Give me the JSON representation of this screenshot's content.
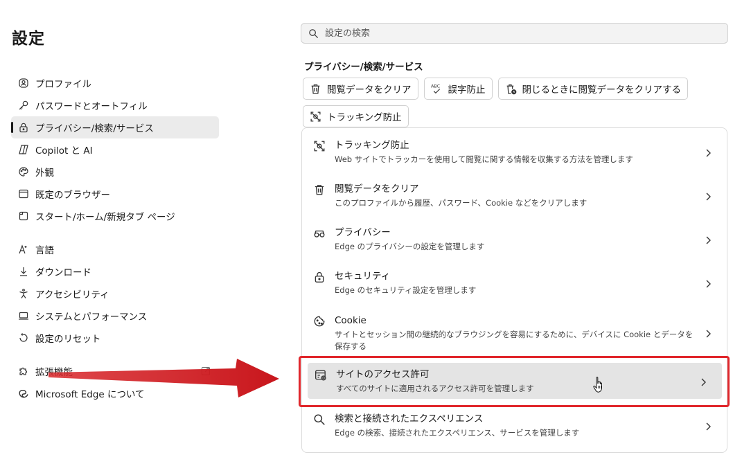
{
  "page_title": "設定",
  "search": {
    "placeholder": "設定の検索"
  },
  "nav": {
    "groups": [
      [
        {
          "label": "プロファイル",
          "icon": "profile-icon"
        },
        {
          "label": "パスワードとオートフィル",
          "icon": "key-icon"
        },
        {
          "label": "プライバシー/検索/サービス",
          "icon": "lock-icon",
          "active": true
        },
        {
          "label": "Copilot と AI",
          "icon": "copilot-icon"
        },
        {
          "label": "外観",
          "icon": "palette-icon"
        },
        {
          "label": "既定のブラウザー",
          "icon": "browser-icon"
        },
        {
          "label": "スタート/ホーム/新規タブ ページ",
          "icon": "home-icon"
        }
      ],
      [
        {
          "label": "言語",
          "icon": "language-icon"
        },
        {
          "label": "ダウンロード",
          "icon": "download-icon"
        },
        {
          "label": "アクセシビリティ",
          "icon": "accessibility-icon"
        },
        {
          "label": "システムとパフォーマンス",
          "icon": "laptop-icon"
        },
        {
          "label": "設定のリセット",
          "icon": "reset-icon"
        }
      ],
      [
        {
          "label": "拡張機能",
          "icon": "puzzle-icon"
        },
        {
          "label": "Microsoft Edge について",
          "icon": "edge-icon"
        }
      ]
    ]
  },
  "section": {
    "title": "プライバシー/検索/サービス",
    "chips": [
      {
        "label": "閲覧データをクリア",
        "icon": "trash-icon"
      },
      {
        "label": "誤字防止",
        "icon": "spellcheck-icon"
      },
      {
        "label": "閉じるときに閲覧データをクリアする",
        "icon": "trash-clock-icon"
      },
      {
        "label": "トラッキング防止",
        "icon": "tracking-icon"
      }
    ],
    "rows": [
      {
        "title": "トラッキング防止",
        "desc": "Web サイトでトラッカーを使用して閲覧に関する情報を収集する方法を管理します",
        "icon": "tracking-icon"
      },
      {
        "title": "閲覧データをクリア",
        "desc": "このプロファイルから履歴、パスワード、Cookie などをクリアします",
        "icon": "trash-icon"
      },
      {
        "title": "プライバシー",
        "desc": "Edge のプライバシーの設定を管理します",
        "icon": "glasses-icon"
      },
      {
        "title": "セキュリティ",
        "desc": "Edge のセキュリティ設定を管理します",
        "icon": "lock-icon"
      },
      {
        "title": "Cookie",
        "desc": "サイトとセッション間の継続的なブラウジングを容易にするために、デバイスに Cookie とデータを保存する",
        "icon": "cookie-icon"
      },
      {
        "title": "サイトのアクセス許可",
        "desc": "すべてのサイトに適用されるアクセス許可を管理します",
        "icon": "site-permissions-icon",
        "highlighted": true
      },
      {
        "title": "検索と接続されたエクスペリエンス",
        "desc": "Edge の検索、接続されたエクスペリエンス、サービスを管理します",
        "icon": "search-icon"
      }
    ]
  },
  "colors": {
    "highlight_border": "#e0262b",
    "arrow": "#d9282c",
    "active_bg": "#ebebeb"
  }
}
